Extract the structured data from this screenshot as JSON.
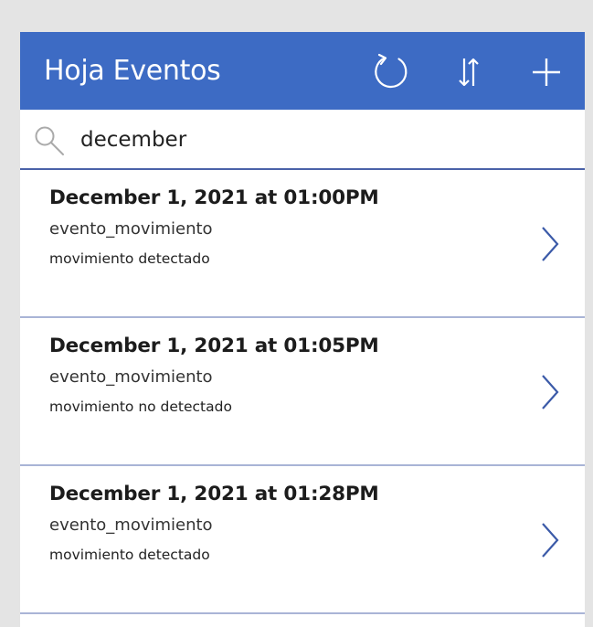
{
  "header": {
    "title": "Hoja Eventos",
    "refresh_icon": "refresh-icon",
    "sort_icon": "sort-icon",
    "add_icon": "add-icon",
    "background_color": "#3d6bc4"
  },
  "search": {
    "value": "december",
    "icon": "search-icon"
  },
  "gallery": {
    "items": [
      {
        "title": "December 1, 2021 at 01:00PM",
        "subtitle": "evento_movimiento",
        "description": "movimiento detectado"
      },
      {
        "title": "December 1, 2021 at 01:05PM",
        "subtitle": "evento_movimiento",
        "description": "movimiento no detectado"
      },
      {
        "title": "December 1, 2021 at 01:28PM",
        "subtitle": "evento_movimiento",
        "description": "movimiento detectado"
      }
    ],
    "next_icon": "chevron-right-icon",
    "separator_color": "#a9b4d6"
  }
}
